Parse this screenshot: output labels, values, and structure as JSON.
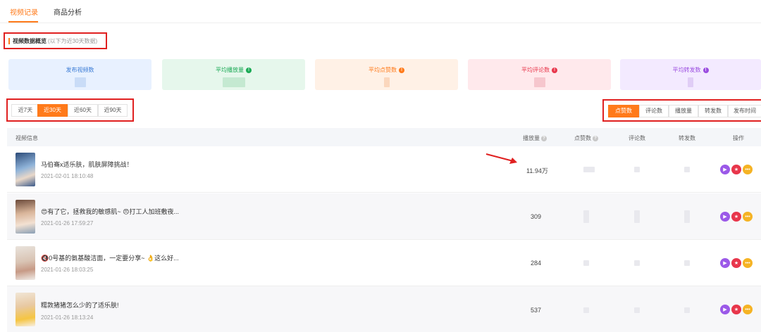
{
  "top_tabs": [
    {
      "label": "视频记录",
      "active": true
    },
    {
      "label": "商品分析",
      "active": false
    }
  ],
  "section": {
    "title": "视频数据概览",
    "subtitle": "(以下为近30天数据)"
  },
  "stats": [
    {
      "label": "发布视频数",
      "info": false,
      "bg": "#e8f1ff",
      "color": "#3a7bd5",
      "mask": "#c9dcf7"
    },
    {
      "label": "平均播放量",
      "info": true,
      "bg": "#e6f7ec",
      "color": "#1aaa55",
      "mask": "#c4e9d1"
    },
    {
      "label": "平均点赞数",
      "info": true,
      "bg": "#fff1e6",
      "color": "#ff7a1a",
      "mask": "#fbd7bd"
    },
    {
      "label": "平均评论数",
      "info": true,
      "bg": "#ffe9ec",
      "color": "#e8364b",
      "mask": "#f6c6cd"
    },
    {
      "label": "平均转发数",
      "info": true,
      "bg": "#f3eaff",
      "color": "#9b4de0",
      "mask": "#e0cdf6"
    }
  ],
  "periods": [
    {
      "label": "近7天",
      "active": false
    },
    {
      "label": "近30天",
      "active": true
    },
    {
      "label": "近60天",
      "active": false
    },
    {
      "label": "近90天",
      "active": false
    }
  ],
  "sort_options": [
    {
      "label": "点赞数",
      "active": true
    },
    {
      "label": "评论数",
      "active": false
    },
    {
      "label": "播放量",
      "active": false
    },
    {
      "label": "转发数",
      "active": false
    },
    {
      "label": "发布时间",
      "active": false
    }
  ],
  "table": {
    "headers": {
      "video": "视频信息",
      "plays": "播放量",
      "likes": "点赞数",
      "comments": "评论数",
      "shares": "转发数",
      "ops": "操作"
    },
    "rows": [
      {
        "title": "马伯骞x适乐肤，肌肤屏障挑战！",
        "time": "2021-02-01 18:10:48",
        "plays": "11.94万"
      },
      {
        "title": "😍有了它，拯救我的敏感肌~ 😠打工人加班敷夜...",
        "time": "2021-01-26 17:59:27",
        "plays": "309"
      },
      {
        "title": "🔇0号基的氨基酸洁面，一定要分享~ 👌这么好...",
        "time": "2021-01-26 18:03:25",
        "plays": "284"
      },
      {
        "title": "糯敦猪猪怎么少的了适乐肤!",
        "time": "2021-01-26 18:13:24",
        "plays": "537"
      }
    ]
  },
  "colors": {
    "accent": "#ff7a1a",
    "highlight_box": "#e02020",
    "op_play": "#9b59e8",
    "op_star": "#e8364b",
    "op_more": "#f5b324"
  },
  "icons": {
    "op_play": "play-icon",
    "op_star": "star-icon",
    "op_more": "more-icon"
  }
}
